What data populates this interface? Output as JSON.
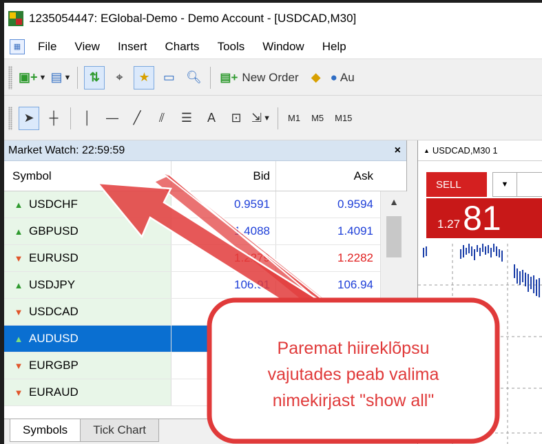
{
  "window": {
    "title": "1235054447: EGlobal-Demo - Demo Account - [USDCAD,M30]"
  },
  "menu": {
    "items": [
      "File",
      "View",
      "Insert",
      "Charts",
      "Tools",
      "Window",
      "Help"
    ]
  },
  "toolbar": {
    "new_order_label": "New Order",
    "autotrading_label": "Au",
    "timeframes": [
      "M1",
      "M5",
      "M15"
    ],
    "text_tool": "A"
  },
  "market_watch": {
    "title": "Market Watch: 22:59:59",
    "close_label": "×",
    "columns": {
      "symbol": "Symbol",
      "bid": "Bid",
      "ask": "Ask"
    },
    "rows": [
      {
        "symbol": "USDCHF",
        "dir": "up",
        "bid": "0.9591",
        "ask": "0.9594",
        "color": "blue"
      },
      {
        "symbol": "GBPUSD",
        "dir": "up",
        "bid": "1.4088",
        "ask": "1.4091",
        "color": "blue"
      },
      {
        "symbol": "EURUSD",
        "dir": "down",
        "bid": "1.2279",
        "ask": "1.2282",
        "color": "red"
      },
      {
        "symbol": "USDJPY",
        "dir": "up",
        "bid": "106.91",
        "ask": "106.94",
        "color": "blue"
      },
      {
        "symbol": "USDCAD",
        "dir": "down",
        "bid": "",
        "ask": "",
        "color": "blue"
      },
      {
        "symbol": "AUDUSD",
        "dir": "up",
        "bid": "",
        "ask": "",
        "color": "blue",
        "selected": true
      },
      {
        "symbol": "EURGBP",
        "dir": "down",
        "bid": "",
        "ask": "",
        "color": "red"
      },
      {
        "symbol": "EURAUD",
        "dir": "down",
        "bid": "",
        "ask": "",
        "color": "red"
      }
    ],
    "tabs": [
      "Symbols",
      "Tick Chart"
    ]
  },
  "chart": {
    "title": "USDCAD,M30 1",
    "sell_label": "SELL",
    "price_small": "1.27",
    "price_big": "81"
  },
  "annotation": {
    "lines": [
      "Paremat hiireklõpsu",
      "vajutades peab valima",
      "nimekirjast  \"show all\""
    ],
    "color": "#e03a3a"
  }
}
